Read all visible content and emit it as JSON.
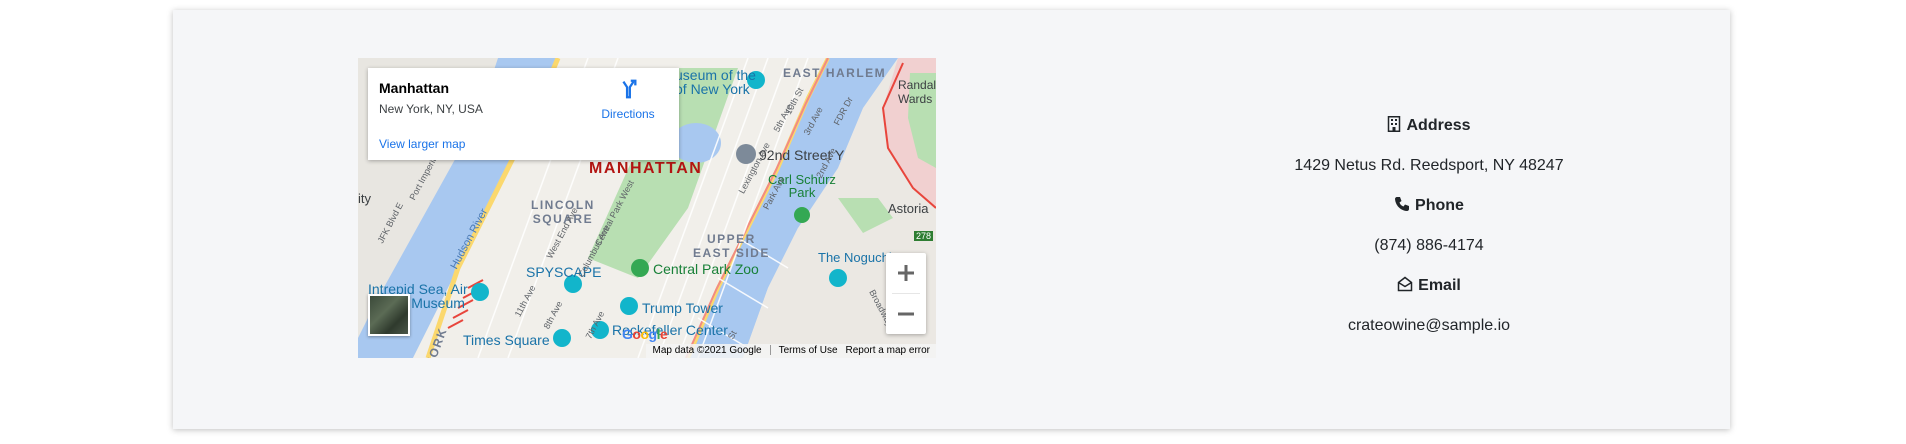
{
  "map": {
    "infobox": {
      "title": "Manhattan",
      "subtitle": "New York, NY, USA",
      "directions_label": "Directions",
      "larger_map_label": "View larger map"
    },
    "labels": {
      "manhattan": "MANHATTAN",
      "east_harlem": "EAST HARLEM",
      "lincoln_square_1": "LINCOLN",
      "lincoln_square_2": "SQUARE",
      "upper_east_side_1": "UPPER",
      "upper_east_side_2": "EAST SIDE",
      "museum_city_ny_1": "useum of the",
      "museum_city_ny_2": "of New York",
      "randalls_1": "Randal",
      "randalls_2": "Wards I",
      "street_92": "92nd Street Y",
      "carl_schurz_1": "Carl Schurz",
      "carl_schurz_2": "Park",
      "astoria": "Astoria",
      "spyscape": "SPYSCAPE",
      "central_park_zoo": "Central Park Zoo",
      "intrepid_1": "Intrepid Sea, Air",
      "intrepid_2": "& Museum",
      "trump_tower": "Trump Tower",
      "rockefeller": "Rockefeller Center",
      "times_square": "Times Square",
      "noguchi": "The Noguchi Mu",
      "hudson_river": "Hudson River",
      "city": "ity",
      "york": "YORK",
      "fdr": "FDR Dr",
      "highway_278": "278"
    },
    "streets": [
      "5th Ave",
      "3rd Ave",
      "10th St",
      "Park Ave",
      "2nd Ave",
      "West End Ave",
      "Central Park West",
      "11th Ave",
      "7th Ave",
      "8th Ave",
      "Broadway",
      "Port Imperial Blvd",
      "JFK Blvd E",
      "Columbus Ave",
      "Lexington Ave",
      "St"
    ],
    "zoom_in_label": "+",
    "zoom_out_label": "−",
    "google_logo": "Google",
    "attribution": {
      "map_data": "Map data ©2021 Google",
      "terms": "Terms of Use",
      "report": "Report a map error"
    },
    "colors": {
      "water": "#a8c8f0",
      "park": "#b8dfb2",
      "road_major": "#fbd86e",
      "highway": "#f28b82"
    }
  },
  "contact": {
    "address_heading": "Address",
    "address_value": "1429 Netus Rd. Reedsport, NY 48247",
    "phone_heading": "Phone",
    "phone_value": "(874) 886-4174",
    "email_heading": "Email",
    "email_value": "crateowine@sample.io"
  }
}
